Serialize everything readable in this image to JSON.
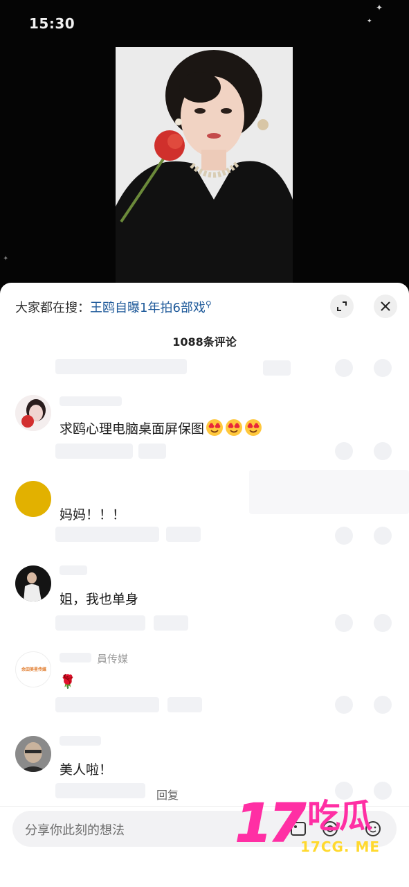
{
  "status": {
    "time": "15:30"
  },
  "sheet": {
    "search_prefix": "大家都在搜：",
    "search_link": "王鸥自曝1年拍6部戏",
    "comment_count": "1088条评论"
  },
  "comments": [
    {
      "text": "求鸥心理电脑桌面屏保图",
      "emoji_count": 3
    },
    {
      "text": "妈妈！！！"
    },
    {
      "text": "姐，我也单身"
    },
    {
      "name": "員传媒",
      "avatar_text": "余田美星传媒",
      "text": "🌹"
    },
    {
      "text": "美人啦！"
    }
  ],
  "reply_label": "回复",
  "input": {
    "placeholder": "分享你此刻的想法"
  },
  "watermark": {
    "big": "17",
    "cn": "吃瓜",
    "url": "17CG. ME"
  },
  "colors": {
    "link": "#1f5a9a",
    "watermark_pink": "#ff2fa4",
    "watermark_yellow": "#ffd92e"
  }
}
